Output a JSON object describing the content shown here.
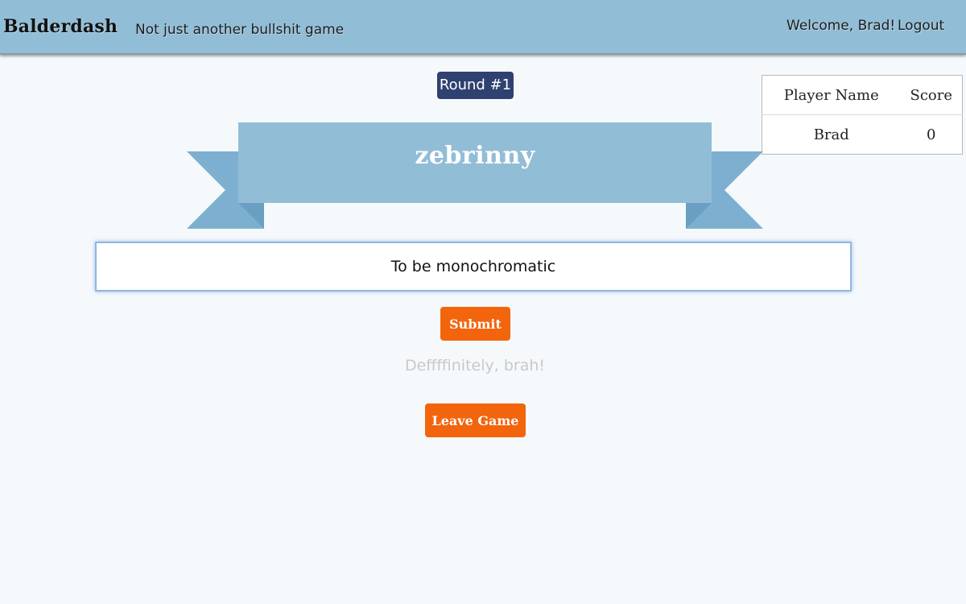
{
  "navbar": {
    "brand": "Balderdash",
    "tagline": "Not just another bullshit game",
    "welcome": "Welcome, Brad!",
    "logout_label": "Logout"
  },
  "round": {
    "label": "Round #1"
  },
  "scoreboard": {
    "headers": [
      "Player Name",
      "Score"
    ],
    "rows": [
      {
        "player": "Brad",
        "score": "0"
      }
    ]
  },
  "word": {
    "text": "zebrinny"
  },
  "definition_input": {
    "value": "To be monochromatic"
  },
  "actions": {
    "submit_label": "Submit",
    "leave_label": "Leave Game"
  },
  "status": {
    "message": "Deffffinitely, brah!"
  },
  "colors": {
    "navbar": "#92bdd6",
    "round_badge": "#2f4170",
    "banner": "#92bdd6",
    "button": "#f2650d"
  }
}
